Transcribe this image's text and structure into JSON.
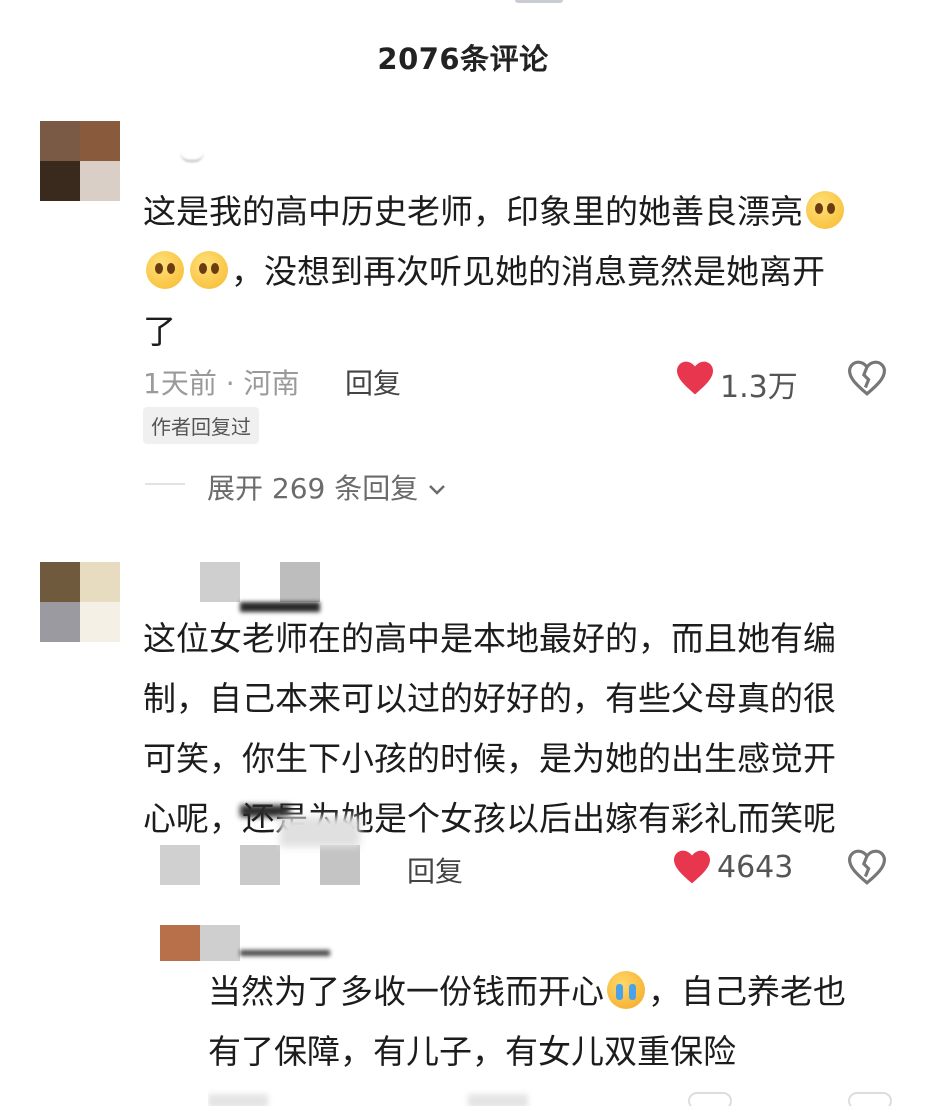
{
  "header": {
    "title": "2076条评论"
  },
  "comments": [
    {
      "avatar_colors": [
        "#7a5a44",
        "#8a5a3c",
        "#3a2a1e",
        "#d9cfc6"
      ],
      "lines": [
        "这是我的高中历史老师，印象里的她善良漂亮",
        "，没想到再次听见她的消息竟然是她离开",
        "了"
      ],
      "meta": "1天前 · 河南",
      "reply_label": "回复",
      "likes": "1.3万",
      "author_badge": "作者回复过",
      "expand_label": "展开 269 条回复"
    },
    {
      "avatar_colors": [
        "#6f5a3e",
        "#e8dcc0",
        "#9a9aa0",
        "#ffffff"
      ],
      "lines": [
        "这位女老师在的高中是本地最好的，而且她有编",
        "制，自己本来可以过的好好的，有些父母真的很",
        "可笑，你生下小孩的时候，是为她的出生感觉开",
        "心呢，还是为她是个女孩以后出嫁有彩礼而笑呢"
      ],
      "reply_label": "回复",
      "likes": "4643"
    }
  ],
  "sub_reply": {
    "lines": [
      "当然为了多收一份钱而开心",
      "，自己养老也",
      "有了保障，有儿子，有女儿双重保险"
    ]
  },
  "icons": {
    "heart": "heart-icon",
    "dislike": "broken-heart-icon",
    "chevron": "chevron-down-icon",
    "emoji_pleading": "pleading-face-icon",
    "emoji_crying": "crying-face-icon"
  },
  "colors": {
    "heart": "#e8364e",
    "text": "#1c1c1c",
    "meta": "#9a9a9a"
  }
}
